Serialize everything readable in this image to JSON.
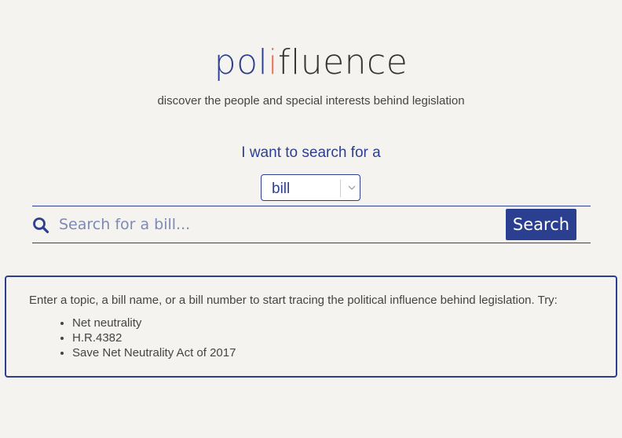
{
  "logo": {
    "part_a": "pol",
    "part_b": "i",
    "part_c": "fluence"
  },
  "tagline": "discover the people and special interests behind legislation",
  "search_prompt": "I want to search for a",
  "type_select": {
    "selected": "bill"
  },
  "search": {
    "placeholder": "Search for a bill...",
    "value": "",
    "button_label": "Search"
  },
  "info": {
    "intro": "Enter a topic, a bill name, or a bill number to start tracing the political influence behind legislation. Try:",
    "examples": [
      "Net neutrality",
      "H.R.4382",
      "Save Net Neutrality Act of 2017"
    ]
  },
  "colors": {
    "brand_blue": "#2d3f8f",
    "brand_accent": "#e8735a",
    "background": "#f5f3ef"
  },
  "icons": {
    "search": "search-icon",
    "dropdown": "chevron-down-icon"
  }
}
